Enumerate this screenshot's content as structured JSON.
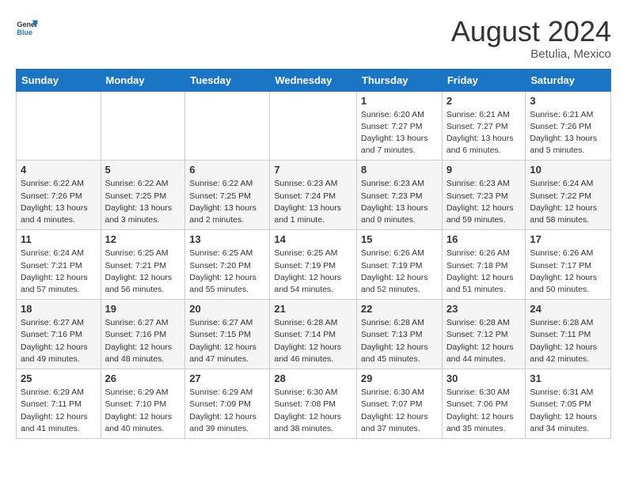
{
  "header": {
    "logo_line1": "General",
    "logo_line2": "Blue",
    "month_year": "August 2024",
    "location": "Betulia, Mexico"
  },
  "days_of_week": [
    "Sunday",
    "Monday",
    "Tuesday",
    "Wednesday",
    "Thursday",
    "Friday",
    "Saturday"
  ],
  "weeks": [
    [
      {
        "day": "",
        "info": ""
      },
      {
        "day": "",
        "info": ""
      },
      {
        "day": "",
        "info": ""
      },
      {
        "day": "",
        "info": ""
      },
      {
        "day": "1",
        "info": "Sunrise: 6:20 AM\nSunset: 7:27 PM\nDaylight: 13 hours\nand 7 minutes."
      },
      {
        "day": "2",
        "info": "Sunrise: 6:21 AM\nSunset: 7:27 PM\nDaylight: 13 hours\nand 6 minutes."
      },
      {
        "day": "3",
        "info": "Sunrise: 6:21 AM\nSunset: 7:26 PM\nDaylight: 13 hours\nand 5 minutes."
      }
    ],
    [
      {
        "day": "4",
        "info": "Sunrise: 6:22 AM\nSunset: 7:26 PM\nDaylight: 13 hours\nand 4 minutes."
      },
      {
        "day": "5",
        "info": "Sunrise: 6:22 AM\nSunset: 7:25 PM\nDaylight: 13 hours\nand 3 minutes."
      },
      {
        "day": "6",
        "info": "Sunrise: 6:22 AM\nSunset: 7:25 PM\nDaylight: 13 hours\nand 2 minutes."
      },
      {
        "day": "7",
        "info": "Sunrise: 6:23 AM\nSunset: 7:24 PM\nDaylight: 13 hours\nand 1 minute."
      },
      {
        "day": "8",
        "info": "Sunrise: 6:23 AM\nSunset: 7:23 PM\nDaylight: 13 hours\nand 0 minutes."
      },
      {
        "day": "9",
        "info": "Sunrise: 6:23 AM\nSunset: 7:23 PM\nDaylight: 12 hours\nand 59 minutes."
      },
      {
        "day": "10",
        "info": "Sunrise: 6:24 AM\nSunset: 7:22 PM\nDaylight: 12 hours\nand 58 minutes."
      }
    ],
    [
      {
        "day": "11",
        "info": "Sunrise: 6:24 AM\nSunset: 7:21 PM\nDaylight: 12 hours\nand 57 minutes."
      },
      {
        "day": "12",
        "info": "Sunrise: 6:25 AM\nSunset: 7:21 PM\nDaylight: 12 hours\nand 56 minutes."
      },
      {
        "day": "13",
        "info": "Sunrise: 6:25 AM\nSunset: 7:20 PM\nDaylight: 12 hours\nand 55 minutes."
      },
      {
        "day": "14",
        "info": "Sunrise: 6:25 AM\nSunset: 7:19 PM\nDaylight: 12 hours\nand 54 minutes."
      },
      {
        "day": "15",
        "info": "Sunrise: 6:26 AM\nSunset: 7:19 PM\nDaylight: 12 hours\nand 52 minutes."
      },
      {
        "day": "16",
        "info": "Sunrise: 6:26 AM\nSunset: 7:18 PM\nDaylight: 12 hours\nand 51 minutes."
      },
      {
        "day": "17",
        "info": "Sunrise: 6:26 AM\nSunset: 7:17 PM\nDaylight: 12 hours\nand 50 minutes."
      }
    ],
    [
      {
        "day": "18",
        "info": "Sunrise: 6:27 AM\nSunset: 7:16 PM\nDaylight: 12 hours\nand 49 minutes."
      },
      {
        "day": "19",
        "info": "Sunrise: 6:27 AM\nSunset: 7:16 PM\nDaylight: 12 hours\nand 48 minutes."
      },
      {
        "day": "20",
        "info": "Sunrise: 6:27 AM\nSunset: 7:15 PM\nDaylight: 12 hours\nand 47 minutes."
      },
      {
        "day": "21",
        "info": "Sunrise: 6:28 AM\nSunset: 7:14 PM\nDaylight: 12 hours\nand 46 minutes."
      },
      {
        "day": "22",
        "info": "Sunrise: 6:28 AM\nSunset: 7:13 PM\nDaylight: 12 hours\nand 45 minutes."
      },
      {
        "day": "23",
        "info": "Sunrise: 6:28 AM\nSunset: 7:12 PM\nDaylight: 12 hours\nand 44 minutes."
      },
      {
        "day": "24",
        "info": "Sunrise: 6:28 AM\nSunset: 7:11 PM\nDaylight: 12 hours\nand 42 minutes."
      }
    ],
    [
      {
        "day": "25",
        "info": "Sunrise: 6:29 AM\nSunset: 7:11 PM\nDaylight: 12 hours\nand 41 minutes."
      },
      {
        "day": "26",
        "info": "Sunrise: 6:29 AM\nSunset: 7:10 PM\nDaylight: 12 hours\nand 40 minutes."
      },
      {
        "day": "27",
        "info": "Sunrise: 6:29 AM\nSunset: 7:09 PM\nDaylight: 12 hours\nand 39 minutes."
      },
      {
        "day": "28",
        "info": "Sunrise: 6:30 AM\nSunset: 7:08 PM\nDaylight: 12 hours\nand 38 minutes."
      },
      {
        "day": "29",
        "info": "Sunrise: 6:30 AM\nSunset: 7:07 PM\nDaylight: 12 hours\nand 37 minutes."
      },
      {
        "day": "30",
        "info": "Sunrise: 6:30 AM\nSunset: 7:06 PM\nDaylight: 12 hours\nand 35 minutes."
      },
      {
        "day": "31",
        "info": "Sunrise: 6:31 AM\nSunset: 7:05 PM\nDaylight: 12 hours\nand 34 minutes."
      }
    ]
  ]
}
